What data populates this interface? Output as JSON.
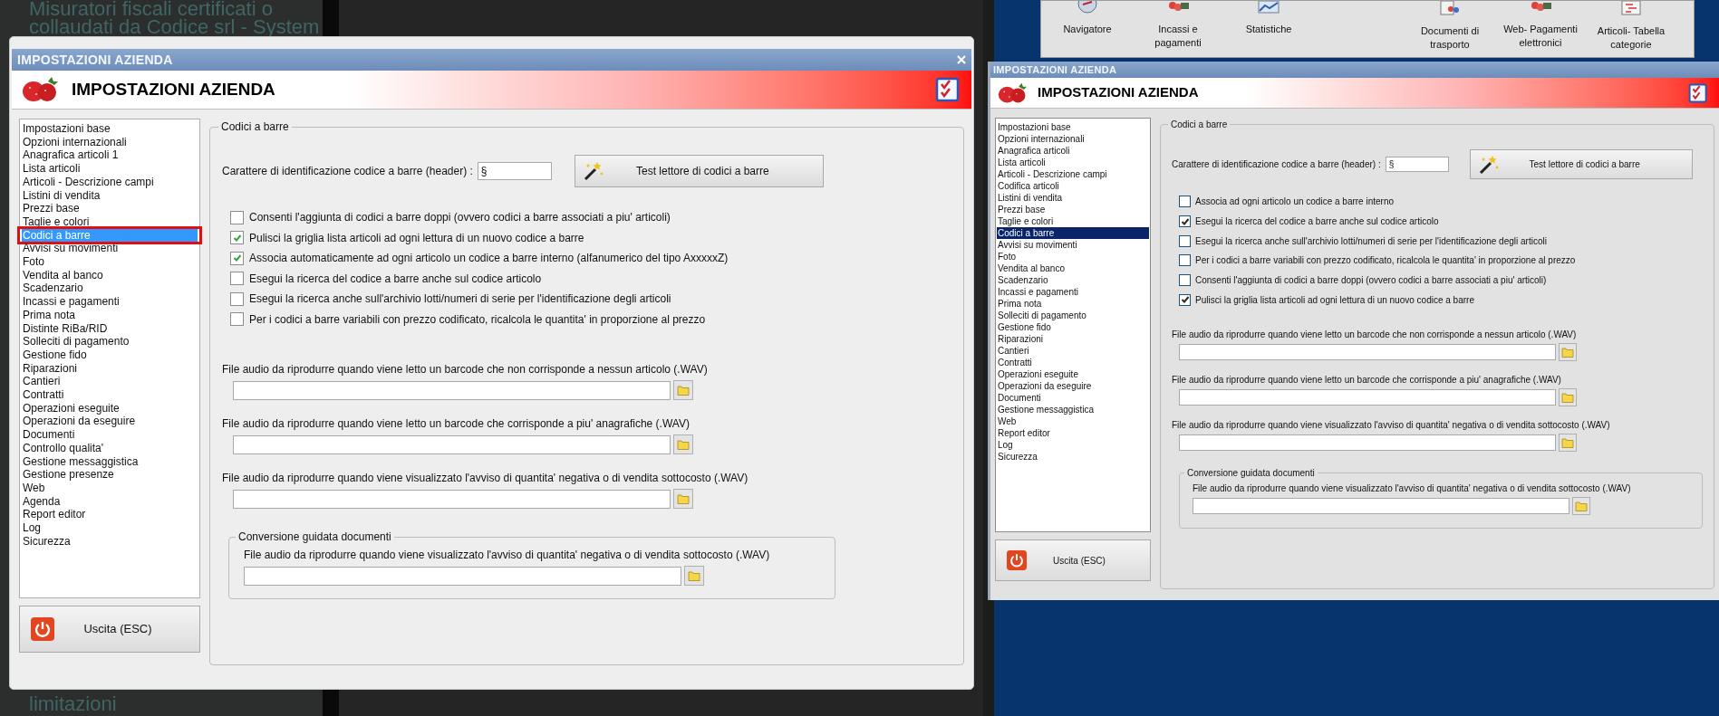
{
  "background": {
    "top_texts": [
      "Misuratori fiscali certificati o",
      "collaudati da Codice srl - System"
    ],
    "bottom_text": "limitazioni"
  },
  "toolbar": {
    "items": [
      {
        "label": "Navigatore"
      },
      {
        "label": "Incassi e pagamenti"
      },
      {
        "label": "Statistiche"
      },
      {
        "label": "Documenti di trasporto"
      },
      {
        "label": "Web- Pagamenti elettronici"
      },
      {
        "label": "Articoli- Tabella categorie"
      }
    ]
  },
  "dialogs": [
    {
      "kind": "modern",
      "window_title": "IMPOSTAZIONI AZIENDA",
      "header_title": "IMPOSTAZIONI AZIENDA",
      "sidebar": {
        "items": [
          {
            "label": "Impostazioni base",
            "selected": false,
            "highlighted": false
          },
          {
            "label": "Opzioni internazionali",
            "selected": false,
            "highlighted": false
          },
          {
            "label": "Anagrafica articoli 1",
            "selected": false,
            "highlighted": false
          },
          {
            "label": "Lista articoli",
            "selected": false,
            "highlighted": false
          },
          {
            "label": "Articoli - Descrizione campi",
            "selected": false,
            "highlighted": false
          },
          {
            "label": "Listini di vendita",
            "selected": false,
            "highlighted": false
          },
          {
            "label": "Prezzi base",
            "selected": false,
            "highlighted": false
          },
          {
            "label": "Taglie e colori",
            "selected": false,
            "highlighted": false
          },
          {
            "label": "Codici a barre",
            "selected": true,
            "highlighted": true
          },
          {
            "label": "Avvisi su movimenti",
            "selected": false,
            "highlighted": false
          },
          {
            "label": "Foto",
            "selected": false,
            "highlighted": false
          },
          {
            "label": "Vendita al banco",
            "selected": false,
            "highlighted": false
          },
          {
            "label": "Scadenzario",
            "selected": false,
            "highlighted": false
          },
          {
            "label": "Incassi e pagamenti",
            "selected": false,
            "highlighted": false
          },
          {
            "label": "Prima nota",
            "selected": false,
            "highlighted": false
          },
          {
            "label": "Distinte RiBa/RID",
            "selected": false,
            "highlighted": false
          },
          {
            "label": "Solleciti di pagamento",
            "selected": false,
            "highlighted": false
          },
          {
            "label": "Gestione fido",
            "selected": false,
            "highlighted": false
          },
          {
            "label": "Riparazioni",
            "selected": false,
            "highlighted": false
          },
          {
            "label": "Cantieri",
            "selected": false,
            "highlighted": false
          },
          {
            "label": "Contratti",
            "selected": false,
            "highlighted": false
          },
          {
            "label": "Operazioni eseguite",
            "selected": false,
            "highlighted": false
          },
          {
            "label": "Operazioni da eseguire",
            "selected": false,
            "highlighted": false
          },
          {
            "label": "Documenti",
            "selected": false,
            "highlighted": false
          },
          {
            "label": "Controllo qualita'",
            "selected": false,
            "highlighted": false
          },
          {
            "label": "Gestione messaggistica",
            "selected": false,
            "highlighted": false
          },
          {
            "label": "Gestione presenze",
            "selected": false,
            "highlighted": false
          },
          {
            "label": "Web",
            "selected": false,
            "highlighted": false
          },
          {
            "label": "Agenda",
            "selected": false,
            "highlighted": false
          },
          {
            "label": "Report editor",
            "selected": false,
            "highlighted": false
          },
          {
            "label": "Log",
            "selected": false,
            "highlighted": false
          },
          {
            "label": "Sicurezza",
            "selected": false,
            "highlighted": false
          }
        ]
      },
      "exit_button": "Uscita (ESC)",
      "group": {
        "title": "Codici a barre",
        "header_field": {
          "label": "Carattere di identificazione codice a barre (header) :",
          "value": "§"
        },
        "test_button": "Test lettore di codici a barre",
        "options": [
          {
            "label": "Consenti l'aggiunta di codici a barre doppi (ovvero codici a barre associati a piu' articoli)",
            "checked": false
          },
          {
            "label": "Pulisci la griglia lista articoli ad ogni lettura di un nuovo codice a barre",
            "checked": true
          },
          {
            "label": "Associa automaticamente ad ogni articolo un codice a barre interno (alfanumerico del tipo AxxxxxZ)",
            "checked": true
          },
          {
            "label": "Esegui la ricerca del codice a barre anche sul codice articolo",
            "checked": false
          },
          {
            "label": "Esegui la ricerca anche sull'archivio lotti/numeri di serie per l'identificazione degli articoli",
            "checked": false
          },
          {
            "label": "Per i codici a barre variabili con prezzo codificato, ricalcola le quantita' in proporzione al prezzo",
            "checked": false
          }
        ],
        "audio_files": [
          {
            "label": "File audio da riprodurre quando viene letto un barcode che non corrisponde a nessun articolo (.WAV)"
          },
          {
            "label": "File audio da riprodurre quando viene letto un barcode che corrisponde a piu' anagrafiche (.WAV)"
          },
          {
            "label": "File audio da riprodurre quando viene visualizzato l'avviso di quantita' negativa o di vendita sottocosto (.WAV)"
          }
        ],
        "subgroup": {
          "title": "Conversione guidata documenti",
          "audio_files": [
            {
              "label": "File audio da riprodurre quando viene visualizzato l'avviso di quantita' negativa o di vendita sottocosto (.WAV)"
            }
          ]
        }
      }
    },
    {
      "kind": "classic",
      "window_title": "IMPOSTAZIONI AZIENDA",
      "header_title": "IMPOSTAZIONI AZIENDA",
      "sidebar": {
        "items": [
          {
            "label": "Impostazioni base",
            "selected": false
          },
          {
            "label": "Opzioni internazionali",
            "selected": false
          },
          {
            "label": "Anagrafica articoli",
            "selected": false
          },
          {
            "label": "Lista articoli",
            "selected": false
          },
          {
            "label": "Articoli - Descrizione campi",
            "selected": false
          },
          {
            "label": "Codifica articoli",
            "selected": false
          },
          {
            "label": "Listini di vendita",
            "selected": false
          },
          {
            "label": "Prezzi base",
            "selected": false
          },
          {
            "label": "Taglie e colori",
            "selected": false
          },
          {
            "label": "Codici a barre",
            "selected": true
          },
          {
            "label": "Avvisi su movimenti",
            "selected": false
          },
          {
            "label": "Foto",
            "selected": false
          },
          {
            "label": "Vendita al banco",
            "selected": false
          },
          {
            "label": "Scadenzario",
            "selected": false
          },
          {
            "label": "Incassi e pagamenti",
            "selected": false
          },
          {
            "label": "Prima nota",
            "selected": false
          },
          {
            "label": "Solleciti di pagamento",
            "selected": false
          },
          {
            "label": "Gestione fido",
            "selected": false
          },
          {
            "label": "Riparazioni",
            "selected": false
          },
          {
            "label": "Cantieri",
            "selected": false
          },
          {
            "label": "Contratti",
            "selected": false
          },
          {
            "label": "Operazioni eseguite",
            "selected": false
          },
          {
            "label": "Operazioni da eseguire",
            "selected": false
          },
          {
            "label": "Documenti",
            "selected": false
          },
          {
            "label": "Gestione messaggistica",
            "selected": false
          },
          {
            "label": "Web",
            "selected": false
          },
          {
            "label": "Report editor",
            "selected": false
          },
          {
            "label": "Log",
            "selected": false
          },
          {
            "label": "Sicurezza",
            "selected": false
          }
        ]
      },
      "exit_button": "Uscita (ESC)",
      "group": {
        "title": "Codici a barre",
        "header_field": {
          "label": "Carattere di identificazione codice a barre (header) :",
          "value": "§"
        },
        "test_button": "Test lettore di codici a barre",
        "options": [
          {
            "label": "Associa ad ogni articolo un codice a barre interno",
            "checked": false
          },
          {
            "label": "Esegui la ricerca del codice a barre anche sul codice articolo",
            "checked": true
          },
          {
            "label": "Esegui la ricerca anche sull'archivio lotti/numeri di serie per l'identificazione degli articoli",
            "checked": false
          },
          {
            "label": "Per i codici a barre variabili con prezzo codificato, ricalcola le quantita' in proporzione al prezzo",
            "checked": false
          },
          {
            "label": "Consenti l'aggiunta di codici a barre doppi (ovvero codici a barre associati a piu' articoli)",
            "checked": false
          },
          {
            "label": "Pulisci la griglia lista articoli ad ogni lettura di un nuovo codice a barre",
            "checked": true
          }
        ],
        "audio_files": [
          {
            "label": "File audio da riprodurre quando viene letto un barcode che non corrisponde a nessun articolo (.WAV)"
          },
          {
            "label": "File audio da riprodurre quando viene letto un barcode che corrisponde a piu' anagrafiche (.WAV)"
          },
          {
            "label": "File audio da riprodurre quando viene visualizzato l'avviso di quantita' negativa o di vendita sottocosto (.WAV)"
          }
        ],
        "subgroup": {
          "title": "Conversione guidata documenti",
          "audio_files": [
            {
              "label": "File audio da riprodurre quando viene visualizzato l'avviso di quantita' negativa o di vendita sottocosto (.WAV)"
            }
          ]
        }
      }
    }
  ]
}
